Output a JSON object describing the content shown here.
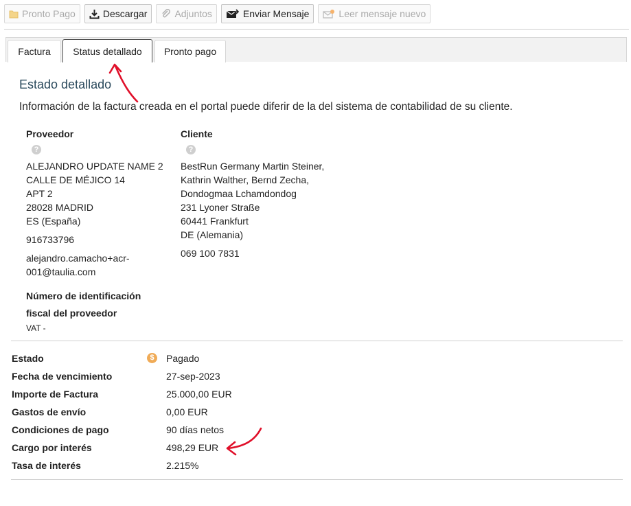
{
  "toolbar": {
    "pronto_pago": "Pronto Pago",
    "descargar": "Descargar",
    "adjuntos": "Adjuntos",
    "enviar_mensaje": "Enviar Mensaje",
    "leer_mensaje": "Leer mensaje nuevo"
  },
  "tabs": [
    "Factura",
    "Status detallado",
    "Pronto pago"
  ],
  "section_title": "Estado detallado",
  "info_text": "Información de la factura creada en el portal puede diferir de la del sistema de contabilidad de su cliente.",
  "proveedor": {
    "heading": "Proveedor",
    "address": [
      "ALEJANDRO UPDATE NAME 2",
      "CALLE DE MÉJICO 14",
      "APT 2",
      "28028 MADRID",
      "ES (España)"
    ],
    "phone": "916733796",
    "email": [
      "alejandro.camacho+acr-",
      "001@taulia.com"
    ]
  },
  "cliente": {
    "heading": "Cliente",
    "address": [
      "BestRun Germany Martin Steiner,",
      "Kathrin Walther, Bernd Zecha,",
      "Dondogmaa Lchamdondog",
      "231 Lyoner Straße",
      "60441 Frankfurt",
      "DE (Alemania)"
    ],
    "phone": "069 100 7831"
  },
  "vat": {
    "label_line1": "Número de identificación",
    "label_line2": "fiscal del proveedor",
    "value": "VAT -"
  },
  "details": [
    {
      "label": "Estado",
      "value": "Pagado",
      "icon": "dollar-status-icon"
    },
    {
      "label": "Fecha de vencimiento",
      "value": "27-sep-2023"
    },
    {
      "label": "Importe de Factura",
      "value": "25.000,00 EUR"
    },
    {
      "label": "Gastos de envío",
      "value": "0,00 EUR"
    },
    {
      "label": "Condiciones de pago",
      "value": "90 días netos"
    },
    {
      "label": "Cargo por interés",
      "value": "498,29 EUR"
    },
    {
      "label": "Tasa de interés",
      "value": "2.215%"
    }
  ],
  "colors": {
    "accent_title": "#2b4a5d",
    "status_icon": "#f0ab57",
    "annotation_arrow": "#e0102a"
  },
  "icons": [
    "folder-icon",
    "download-icon",
    "paperclip-icon",
    "envelope-send-icon",
    "envelope-new-icon",
    "help-icon",
    "dollar-icon"
  ]
}
